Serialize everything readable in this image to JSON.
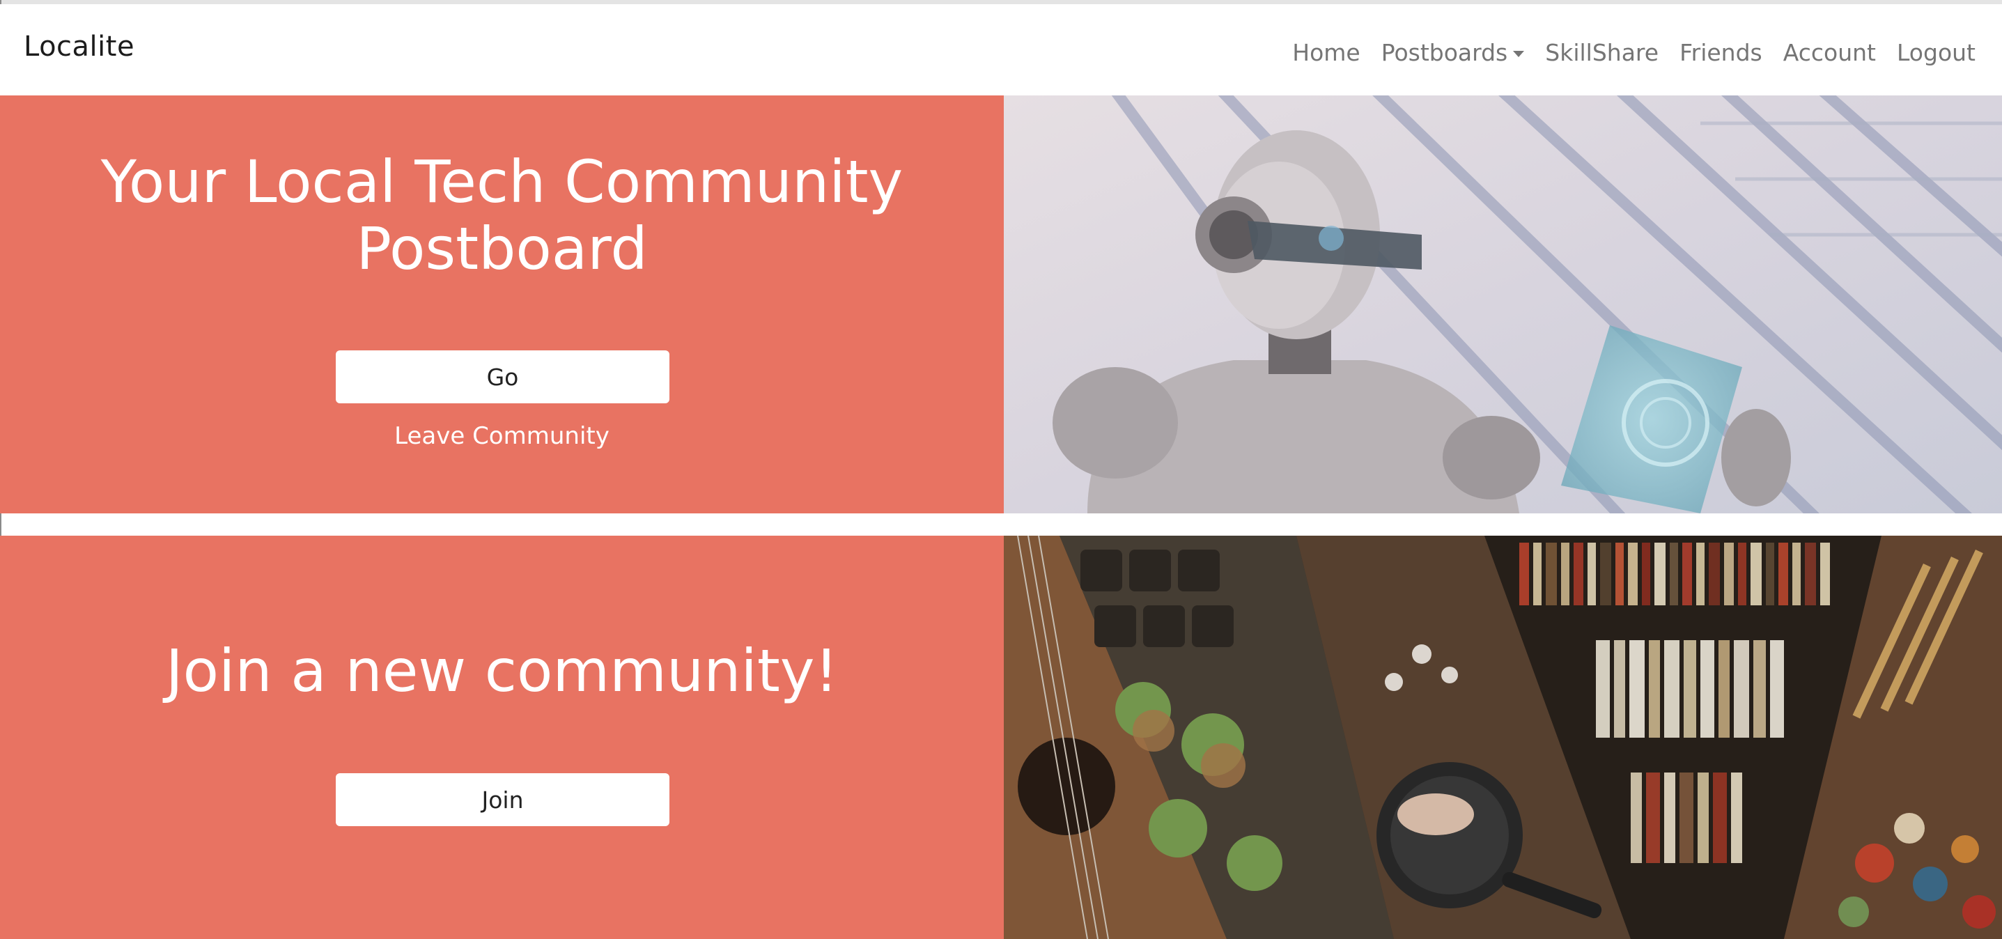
{
  "navbar": {
    "brand": "Localite",
    "links": [
      {
        "label": "Home"
      },
      {
        "label": "Postboards",
        "has_dropdown": true
      },
      {
        "label": "SkillShare"
      },
      {
        "label": "Friends"
      },
      {
        "label": "Account"
      },
      {
        "label": "Logout"
      }
    ]
  },
  "community_section": {
    "title_line1": "Your Local Tech Community",
    "title_line2": "Postboard",
    "go_button": "Go",
    "leave_link": "Leave Community",
    "image_subject": "humanoid robot holding a transparent tablet"
  },
  "join_section": {
    "title": "Join a new community!",
    "join_button": "Join",
    "image_subject": "collage: acoustic guitar, potted seedlings, cooking pan with hands, bookshelf, paint palette and brushes"
  },
  "colors": {
    "accent": "#e87362",
    "navbar_bg": "#ffffff",
    "nav_link": "#757575",
    "brand": "#1c1c1c",
    "button_bg": "#ffffff"
  }
}
